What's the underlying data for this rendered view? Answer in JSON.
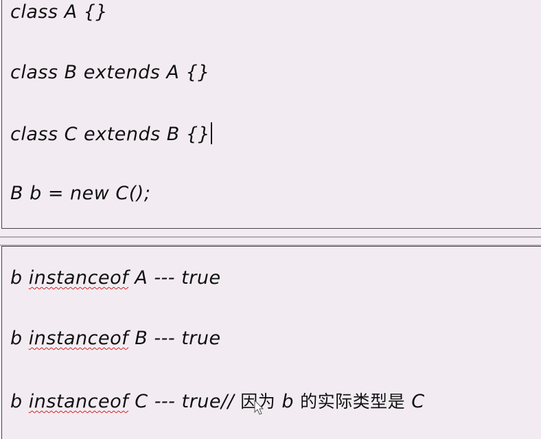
{
  "code": [
    "class A {}",
    "class B extends A {}",
    "class C extends B {}",
    "B b = new C();"
  ],
  "results": [
    {
      "var": "b",
      "kw": "instanceof",
      "cls": "A",
      "sep": "---",
      "val": "true",
      "comment": ""
    },
    {
      "var": "b",
      "kw": "instanceof",
      "cls": "B",
      "sep": "---",
      "val": "true",
      "comment": ""
    },
    {
      "var": "b",
      "kw": "instanceof",
      "cls": "C",
      "sep": "---",
      "val": "true",
      "comment_prefix": "//",
      "comment_cn1": "因为",
      "comment_var": "b",
      "comment_cn2": "的实际类型是",
      "comment_cls": "C"
    }
  ]
}
